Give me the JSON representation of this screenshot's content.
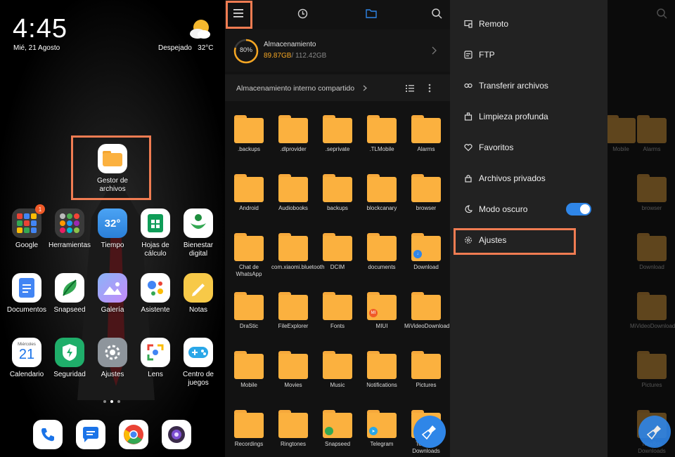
{
  "home": {
    "clock": "4:45",
    "date": "Mié, 21 Agosto",
    "weather_text": "Despejado",
    "temperature": "32°C",
    "highlight_app": "Gestor de archivos",
    "apps": [
      {
        "name": "Google",
        "badge": "1",
        "icon": "google-folder-icon"
      },
      {
        "name": "Herramientas",
        "icon": "tools-folder-icon"
      },
      {
        "name": "Tiempo",
        "temp": "32°",
        "icon": "weather-icon"
      },
      {
        "name": "Hojas de cálculo",
        "icon": "sheets-icon"
      },
      {
        "name": "Bienestar digital",
        "icon": "wellbeing-icon"
      },
      {
        "name": "Documentos",
        "icon": "docs-icon"
      },
      {
        "name": "Snapseed",
        "icon": "snapseed-icon"
      },
      {
        "name": "Galería",
        "icon": "gallery-icon"
      },
      {
        "name": "Asistente",
        "icon": "assistant-icon"
      },
      {
        "name": "Notas",
        "icon": "notes-icon"
      },
      {
        "name": "Calendario",
        "cal_day": "Miércoles",
        "cal_num": "21",
        "icon": "calendar-icon"
      },
      {
        "name": "Seguridad",
        "icon": "security-icon"
      },
      {
        "name": "Ajustes",
        "icon": "settings-icon"
      },
      {
        "name": "Lens",
        "icon": "lens-icon"
      },
      {
        "name": "Centro de juegos",
        "icon": "game-center-icon"
      }
    ],
    "dock": [
      "phone-icon",
      "messages-icon",
      "chrome-icon",
      "camera-icon"
    ]
  },
  "files": {
    "storage_label": "Almacenamiento",
    "storage_percent": "80%",
    "storage_used": "89.87GB",
    "storage_total": "/ 112.42GB",
    "breadcrumb": "Almacenamiento interno compartido",
    "folders": [
      ".backups",
      ".dlprovider",
      ".seprivate",
      ".TLMobile",
      "Alarms",
      "Android",
      "Audiobooks",
      "backups",
      "blockcanary",
      "browser",
      "Chat de WhatsApp",
      "com.xiaomi.bluetooth",
      "DCIM",
      "documents",
      "Download",
      "DraStic",
      "FileExplorer",
      "Fonts",
      "MIUI",
      "MiVideoDownload",
      "Mobile",
      "Movies",
      "Music",
      "Notifications",
      "Pictures",
      "Recordings",
      "Ringtones",
      "Snapseed",
      "Telegram",
      "TeraBox Downloads"
    ],
    "miui_badge": "MI"
  },
  "drawer": {
    "items": [
      {
        "label": "Remoto",
        "icon": "remote-icon"
      },
      {
        "label": "FTP",
        "icon": "ftp-icon"
      },
      {
        "label": "Transferir archivos",
        "icon": "transfer-icon"
      },
      {
        "label": "Limpieza profunda",
        "icon": "cleaner-icon"
      },
      {
        "label": "Favoritos",
        "icon": "heart-icon"
      },
      {
        "label": "Archivos privados",
        "icon": "lock-icon"
      },
      {
        "label": "Modo oscuro",
        "icon": "moon-icon",
        "toggle": true
      },
      {
        "label": "Ajustes",
        "icon": "gear-icon"
      }
    ],
    "bg_folders": [
      "Mobile",
      "Alarms",
      "browser",
      "Download",
      "MiVideoDownload",
      "Pictures",
      "TeraBox Downloads"
    ]
  },
  "colors": {
    "accent": "#2f86e8",
    "highlight": "#f07c52",
    "folder": "#fbb13f",
    "storage_ring": "#f5a623"
  }
}
